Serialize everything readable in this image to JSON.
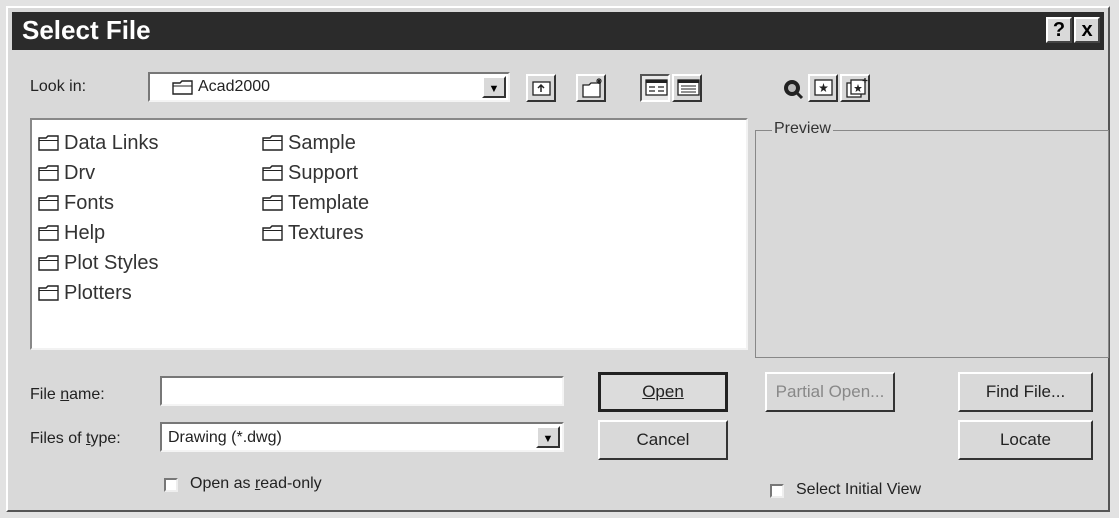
{
  "window": {
    "title": "Select File",
    "help_btn": "?",
    "close_btn": "x"
  },
  "lookin": {
    "label": "Look in:",
    "value": "Acad2000"
  },
  "files": {
    "col1": [
      "Data Links",
      "Drv",
      "Fonts",
      "Help",
      "Plot Styles",
      "Plotters"
    ],
    "col2": [
      "Sample",
      "Support",
      "Template",
      "Textures"
    ]
  },
  "preview": {
    "label": "Preview"
  },
  "filename": {
    "label": "File name:",
    "value": ""
  },
  "filetype": {
    "label": "Files of type:",
    "value": "Drawing (*.dwg)"
  },
  "readonly": {
    "label": "Open as read-only",
    "checked": false
  },
  "buttons": {
    "open": "Open",
    "cancel": "Cancel",
    "partial_open": "Partial Open...",
    "find_file": "Find File...",
    "locate": "Locate"
  },
  "initial_view": {
    "label": "Select Initial View",
    "checked": false
  },
  "icons": [
    "folder-icon",
    "up-one-level-icon",
    "create-new-folder-icon",
    "list-view-icon",
    "details-view-icon",
    "search-web-icon",
    "favorites-icon",
    "add-to-favorites-icon"
  ],
  "colors": {
    "titlebar": "#2b2b2b",
    "face": "#d9d9d9"
  }
}
